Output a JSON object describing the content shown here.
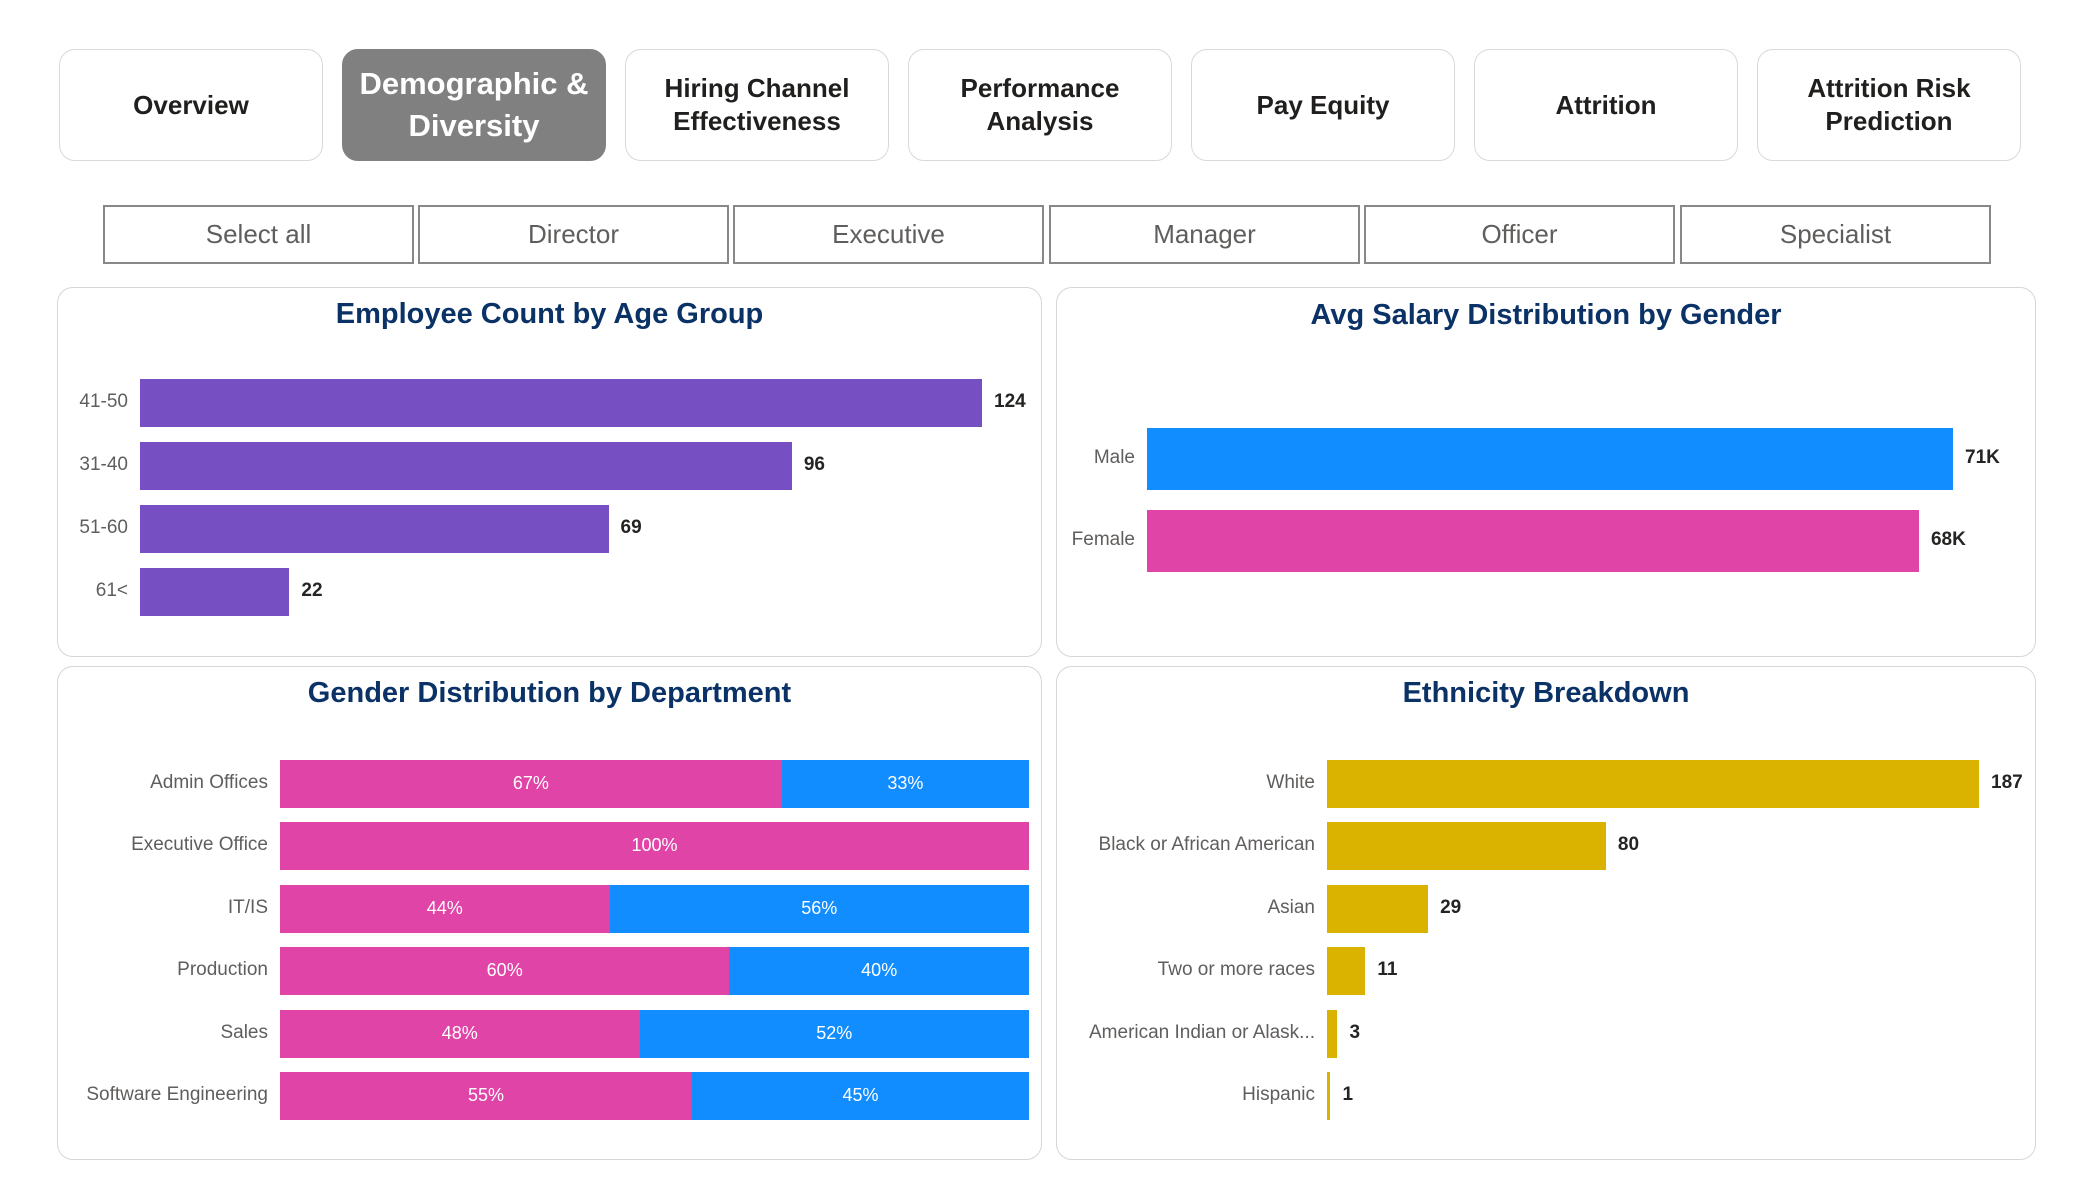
{
  "nav_tabs": [
    {
      "label": "Overview",
      "active": false
    },
    {
      "label": "Demographic &\nDiversity",
      "active": true
    },
    {
      "label": "Hiring Channel\nEffectiveness",
      "active": false
    },
    {
      "label": "Performance Analysis",
      "active": false
    },
    {
      "label": "Pay Equity",
      "active": false
    },
    {
      "label": "Attrition",
      "active": false
    },
    {
      "label": "Attrition Risk\nPrediction",
      "active": false
    }
  ],
  "slicer": [
    "Select all",
    "Director",
    "Executive",
    "Manager",
    "Officer",
    "Specialist"
  ],
  "colors": {
    "purple": "#7650c2",
    "blue": "#118dff",
    "pink": "#e044a7",
    "gold": "#d9b300",
    "title": "#0b3266"
  },
  "chart_data": [
    {
      "type": "bar",
      "orientation": "horizontal",
      "title": "Employee Count by Age Group",
      "categories": [
        "41-50",
        "31-40",
        "51-60",
        "61<"
      ],
      "values": [
        124,
        96,
        69,
        22
      ],
      "value_labels": [
        "124",
        "96",
        "69",
        "22"
      ],
      "color": "#7650c2"
    },
    {
      "type": "bar",
      "orientation": "horizontal",
      "title": "Avg Salary Distribution by Gender",
      "categories": [
        "Male",
        "Female"
      ],
      "values": [
        71000,
        68000
      ],
      "value_labels": [
        "71K",
        "68K"
      ],
      "colors": [
        "#118dff",
        "#e044a7"
      ]
    },
    {
      "type": "bar",
      "orientation": "horizontal",
      "stacked": "percent",
      "title": "Gender Distribution by Department",
      "categories": [
        "Admin Offices",
        "Executive Office",
        "IT/IS",
        "Production",
        "Sales",
        "Software Engineering"
      ],
      "series": [
        {
          "color": "#e044a7",
          "values": [
            67,
            100,
            44,
            60,
            48,
            55
          ],
          "labels": [
            "67%",
            "100%",
            "44%",
            "60%",
            "48%",
            "55%"
          ]
        },
        {
          "color": "#118dff",
          "values": [
            33,
            0,
            56,
            40,
            52,
            45
          ],
          "labels": [
            "33%",
            "",
            "56%",
            "40%",
            "52%",
            "45%"
          ]
        }
      ]
    },
    {
      "type": "bar",
      "orientation": "horizontal",
      "title": "Ethnicity Breakdown",
      "categories": [
        "White",
        "Black or African American",
        "Asian",
        "Two or more races",
        "American Indian or Alask...",
        "Hispanic"
      ],
      "values": [
        187,
        80,
        29,
        11,
        3,
        1
      ],
      "value_labels": [
        "187",
        "80",
        "29",
        "11",
        "3",
        "1"
      ],
      "color": "#d9b300"
    }
  ]
}
